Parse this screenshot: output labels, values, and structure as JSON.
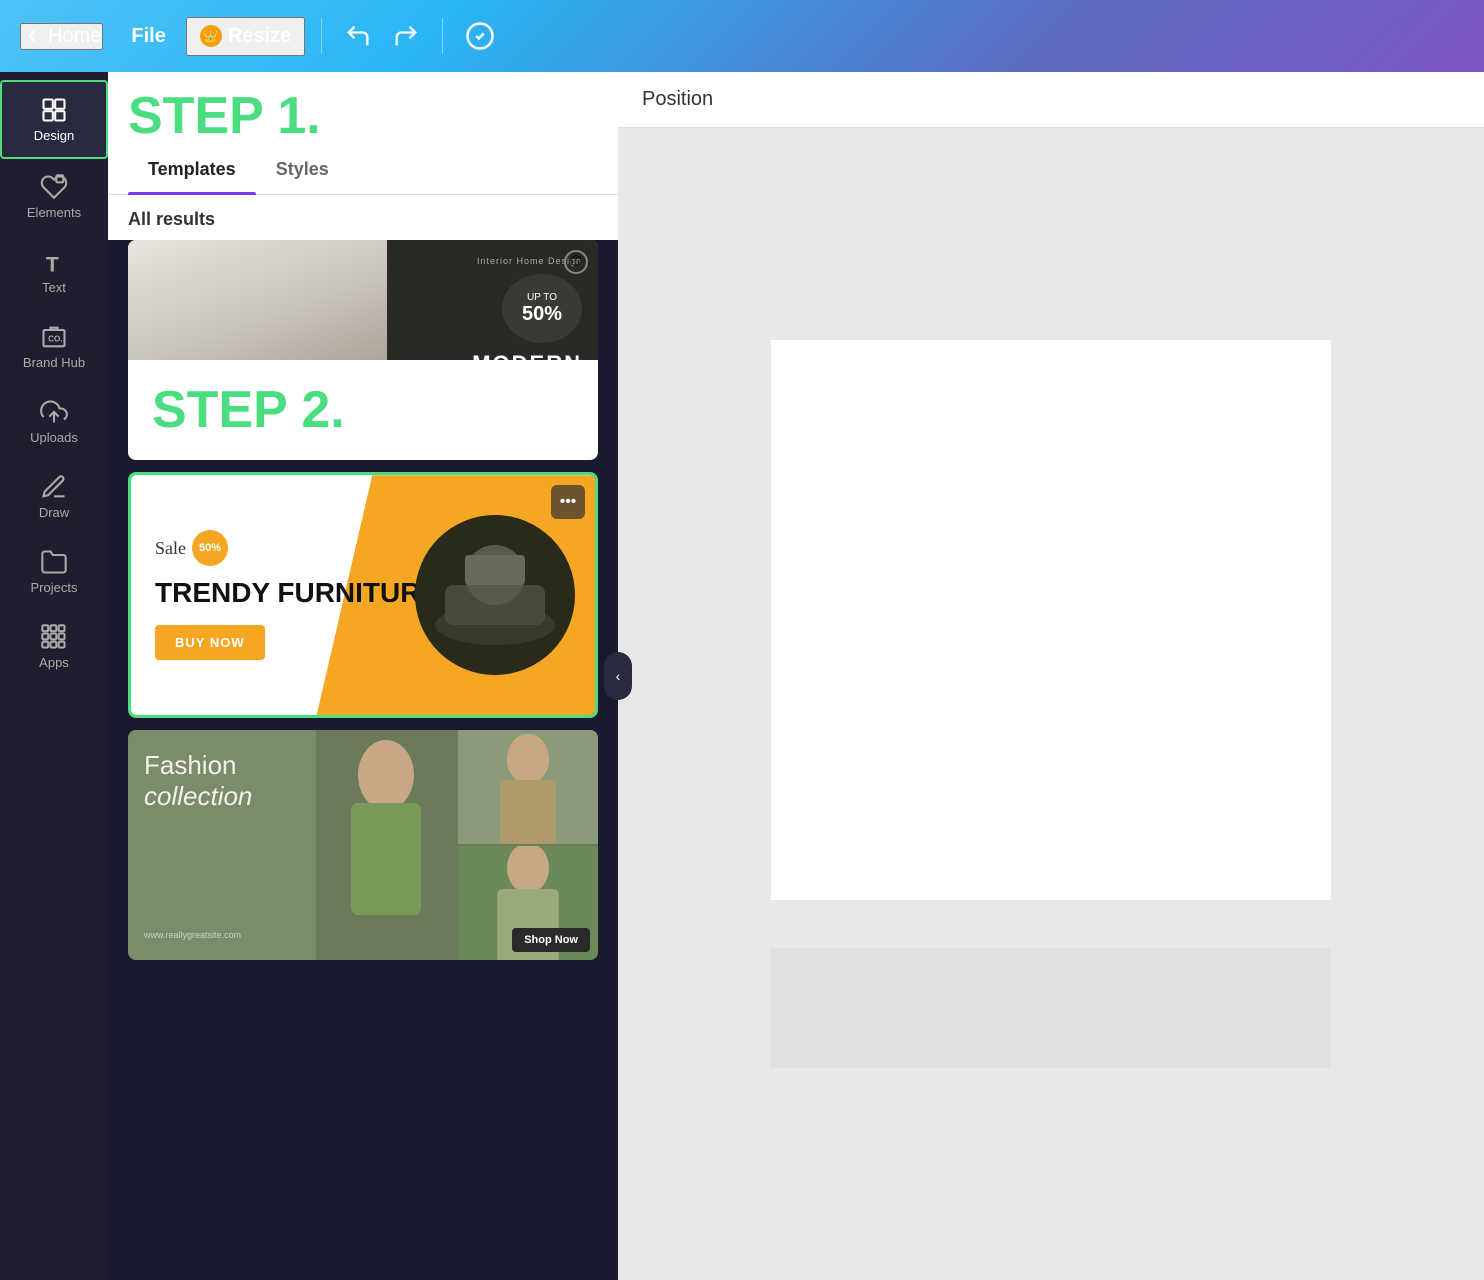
{
  "topbar": {
    "home_label": "Home",
    "file_label": "File",
    "resize_label": "Resize",
    "undo_title": "Undo",
    "redo_title": "Redo",
    "sync_title": "Sync"
  },
  "sidebar": {
    "items": [
      {
        "id": "design",
        "label": "Design",
        "active": true
      },
      {
        "id": "elements",
        "label": "Elements",
        "active": false
      },
      {
        "id": "text",
        "label": "Text",
        "active": false
      },
      {
        "id": "brand-hub",
        "label": "Brand Hub",
        "active": false
      },
      {
        "id": "uploads",
        "label": "Uploads",
        "active": false
      },
      {
        "id": "draw",
        "label": "Draw",
        "active": false
      },
      {
        "id": "projects",
        "label": "Projects",
        "active": false
      },
      {
        "id": "apps",
        "label": "Apps",
        "active": false
      }
    ]
  },
  "panel": {
    "step1_label": "STEP 1.",
    "step2_label": "STEP 2.",
    "tabs": [
      {
        "id": "templates",
        "label": "Templates",
        "active": true
      },
      {
        "id": "styles",
        "label": "Styles",
        "active": false
      }
    ],
    "all_results_label": "All results",
    "templates": [
      {
        "id": "modern-decor",
        "title": "MODERN DECOR FOR YOUR HOME",
        "subtitle": "Interior Home Design",
        "badge": "UP TO 50%"
      },
      {
        "id": "trendy-furniture",
        "title": "TRENDY FURNITURE",
        "sale_label": "Sale",
        "sale_pct": "50%",
        "buy_now": "BUY NOW",
        "selected": true
      },
      {
        "id": "fashion-collection",
        "title": "Fashion collection",
        "shop_now": "Shop Now",
        "url": "www.reallygreatsite.com"
      }
    ]
  },
  "properties": {
    "position_label": "Position"
  },
  "colors": {
    "green_accent": "#4ade80",
    "purple_accent": "#7c3aed",
    "yellow": "#f5a623",
    "topbar_gradient_start": "#4fc3f7",
    "topbar_gradient_end": "#7e57c2"
  }
}
